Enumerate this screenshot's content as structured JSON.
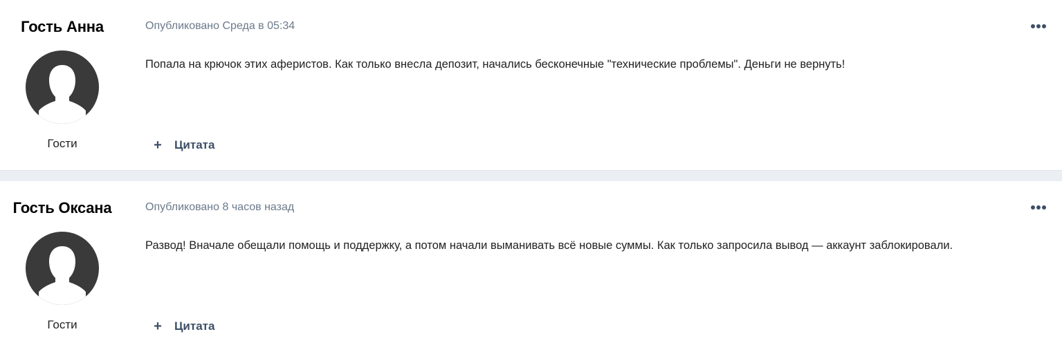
{
  "posts": [
    {
      "author": "Гость Анна",
      "group": "Гости",
      "published": "Опубликовано Среда в 05:34",
      "text": "Попала на крючок этих аферистов. Как только внесла депозит, начались бесконечные \"технические проблемы\". Деньги не вернуть!",
      "quote_icon": "plus-icon",
      "quote_label": "Цитата",
      "menu_icon": "more-options-icon"
    },
    {
      "author": "Гость Оксана",
      "group": "Гости",
      "published": "Опубликовано 8 часов назад",
      "text": "Развод! Вначале обещали помощь и поддержку, а потом начали выманивать всё новые суммы. Как только запросила вывод — аккаунт заблокировали.",
      "quote_icon": "plus-icon",
      "quote_label": "Цитата",
      "menu_icon": "more-options-icon"
    }
  ],
  "colors": {
    "page_background": "#ebeef2",
    "post_background": "#ffffff",
    "meta_text": "#6b7a8b",
    "action_text": "#3d4f66",
    "avatar_fill": "#3a3a3a"
  }
}
